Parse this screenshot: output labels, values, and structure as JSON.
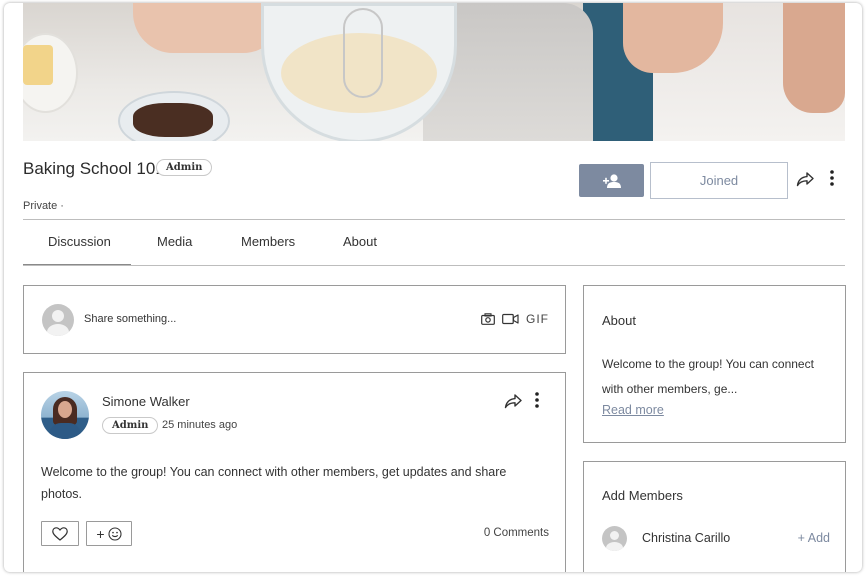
{
  "cover": {
    "alt_icon": "baking-photo"
  },
  "group": {
    "title": "Baking School 101",
    "role_badge": "Admin",
    "privacy": "Private ·"
  },
  "actions": {
    "invite_icon": "add-person-icon",
    "joined_label": "Joined",
    "share_icon": "share-arrow-icon",
    "more_icon": "vertical-dots-icon"
  },
  "tabs": [
    {
      "label": "Discussion",
      "active": true
    },
    {
      "label": "Media",
      "active": false
    },
    {
      "label": "Members",
      "active": false
    },
    {
      "label": "About",
      "active": false
    }
  ],
  "composer": {
    "placeholder": "Share something...",
    "tools": [
      "camera-icon",
      "video-icon"
    ],
    "gif_label": "GIF"
  },
  "post": {
    "author": "Simone Walker",
    "badge": "Admin",
    "time": "25 minutes ago",
    "body": "Welcome to the group! You can connect with other members, get updates and share photos.",
    "reaction_add": "+",
    "comments": "0 Comments"
  },
  "about": {
    "title": "About",
    "text": "Welcome to the group! You can connect with other members, ge...",
    "read_more": "Read more"
  },
  "add_members": {
    "title": "Add Members",
    "members": [
      {
        "name": "Christina Carillo",
        "action": "+ Add"
      }
    ]
  },
  "colors": {
    "accent": "#7d8aa0",
    "border": "#9a9a9a"
  }
}
